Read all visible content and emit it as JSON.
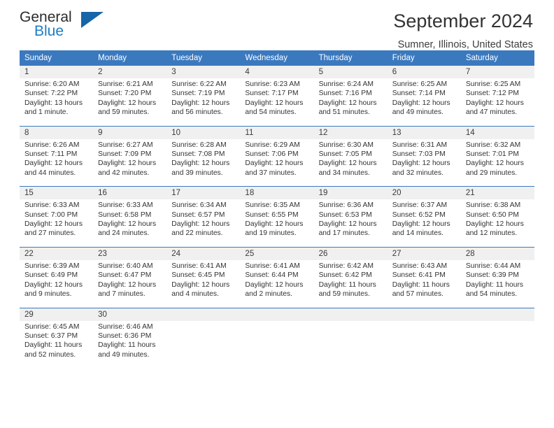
{
  "brand": {
    "name_part1": "General",
    "name_part2": "Blue",
    "accent_color": "#1d7cc2",
    "triangle_color": "#1565a8"
  },
  "header": {
    "title": "September 2024",
    "subtitle": "Sumner, Illinois, United States"
  },
  "theme": {
    "header_row_bg": "#3b79bf",
    "daynum_row_bg": "#f0f0f0",
    "text_color": "#333333"
  },
  "weekday_headers": [
    "Sunday",
    "Monday",
    "Tuesday",
    "Wednesday",
    "Thursday",
    "Friday",
    "Saturday"
  ],
  "labels": {
    "sunrise": "Sunrise:",
    "sunset": "Sunset:",
    "daylight": "Daylight:"
  },
  "weeks": [
    {
      "days": [
        {
          "num": "1",
          "sunrise": "Sunrise: 6:20 AM",
          "sunset": "Sunset: 7:22 PM",
          "daylight1": "Daylight: 13 hours",
          "daylight2": "and 1 minute."
        },
        {
          "num": "2",
          "sunrise": "Sunrise: 6:21 AM",
          "sunset": "Sunset: 7:20 PM",
          "daylight1": "Daylight: 12 hours",
          "daylight2": "and 59 minutes."
        },
        {
          "num": "3",
          "sunrise": "Sunrise: 6:22 AM",
          "sunset": "Sunset: 7:19 PM",
          "daylight1": "Daylight: 12 hours",
          "daylight2": "and 56 minutes."
        },
        {
          "num": "4",
          "sunrise": "Sunrise: 6:23 AM",
          "sunset": "Sunset: 7:17 PM",
          "daylight1": "Daylight: 12 hours",
          "daylight2": "and 54 minutes."
        },
        {
          "num": "5",
          "sunrise": "Sunrise: 6:24 AM",
          "sunset": "Sunset: 7:16 PM",
          "daylight1": "Daylight: 12 hours",
          "daylight2": "and 51 minutes."
        },
        {
          "num": "6",
          "sunrise": "Sunrise: 6:25 AM",
          "sunset": "Sunset: 7:14 PM",
          "daylight1": "Daylight: 12 hours",
          "daylight2": "and 49 minutes."
        },
        {
          "num": "7",
          "sunrise": "Sunrise: 6:25 AM",
          "sunset": "Sunset: 7:12 PM",
          "daylight1": "Daylight: 12 hours",
          "daylight2": "and 47 minutes."
        }
      ]
    },
    {
      "days": [
        {
          "num": "8",
          "sunrise": "Sunrise: 6:26 AM",
          "sunset": "Sunset: 7:11 PM",
          "daylight1": "Daylight: 12 hours",
          "daylight2": "and 44 minutes."
        },
        {
          "num": "9",
          "sunrise": "Sunrise: 6:27 AM",
          "sunset": "Sunset: 7:09 PM",
          "daylight1": "Daylight: 12 hours",
          "daylight2": "and 42 minutes."
        },
        {
          "num": "10",
          "sunrise": "Sunrise: 6:28 AM",
          "sunset": "Sunset: 7:08 PM",
          "daylight1": "Daylight: 12 hours",
          "daylight2": "and 39 minutes."
        },
        {
          "num": "11",
          "sunrise": "Sunrise: 6:29 AM",
          "sunset": "Sunset: 7:06 PM",
          "daylight1": "Daylight: 12 hours",
          "daylight2": "and 37 minutes."
        },
        {
          "num": "12",
          "sunrise": "Sunrise: 6:30 AM",
          "sunset": "Sunset: 7:05 PM",
          "daylight1": "Daylight: 12 hours",
          "daylight2": "and 34 minutes."
        },
        {
          "num": "13",
          "sunrise": "Sunrise: 6:31 AM",
          "sunset": "Sunset: 7:03 PM",
          "daylight1": "Daylight: 12 hours",
          "daylight2": "and 32 minutes."
        },
        {
          "num": "14",
          "sunrise": "Sunrise: 6:32 AM",
          "sunset": "Sunset: 7:01 PM",
          "daylight1": "Daylight: 12 hours",
          "daylight2": "and 29 minutes."
        }
      ]
    },
    {
      "days": [
        {
          "num": "15",
          "sunrise": "Sunrise: 6:33 AM",
          "sunset": "Sunset: 7:00 PM",
          "daylight1": "Daylight: 12 hours",
          "daylight2": "and 27 minutes."
        },
        {
          "num": "16",
          "sunrise": "Sunrise: 6:33 AM",
          "sunset": "Sunset: 6:58 PM",
          "daylight1": "Daylight: 12 hours",
          "daylight2": "and 24 minutes."
        },
        {
          "num": "17",
          "sunrise": "Sunrise: 6:34 AM",
          "sunset": "Sunset: 6:57 PM",
          "daylight1": "Daylight: 12 hours",
          "daylight2": "and 22 minutes."
        },
        {
          "num": "18",
          "sunrise": "Sunrise: 6:35 AM",
          "sunset": "Sunset: 6:55 PM",
          "daylight1": "Daylight: 12 hours",
          "daylight2": "and 19 minutes."
        },
        {
          "num": "19",
          "sunrise": "Sunrise: 6:36 AM",
          "sunset": "Sunset: 6:53 PM",
          "daylight1": "Daylight: 12 hours",
          "daylight2": "and 17 minutes."
        },
        {
          "num": "20",
          "sunrise": "Sunrise: 6:37 AM",
          "sunset": "Sunset: 6:52 PM",
          "daylight1": "Daylight: 12 hours",
          "daylight2": "and 14 minutes."
        },
        {
          "num": "21",
          "sunrise": "Sunrise: 6:38 AM",
          "sunset": "Sunset: 6:50 PM",
          "daylight1": "Daylight: 12 hours",
          "daylight2": "and 12 minutes."
        }
      ]
    },
    {
      "days": [
        {
          "num": "22",
          "sunrise": "Sunrise: 6:39 AM",
          "sunset": "Sunset: 6:49 PM",
          "daylight1": "Daylight: 12 hours",
          "daylight2": "and 9 minutes."
        },
        {
          "num": "23",
          "sunrise": "Sunrise: 6:40 AM",
          "sunset": "Sunset: 6:47 PM",
          "daylight1": "Daylight: 12 hours",
          "daylight2": "and 7 minutes."
        },
        {
          "num": "24",
          "sunrise": "Sunrise: 6:41 AM",
          "sunset": "Sunset: 6:45 PM",
          "daylight1": "Daylight: 12 hours",
          "daylight2": "and 4 minutes."
        },
        {
          "num": "25",
          "sunrise": "Sunrise: 6:41 AM",
          "sunset": "Sunset: 6:44 PM",
          "daylight1": "Daylight: 12 hours",
          "daylight2": "and 2 minutes."
        },
        {
          "num": "26",
          "sunrise": "Sunrise: 6:42 AM",
          "sunset": "Sunset: 6:42 PM",
          "daylight1": "Daylight: 11 hours",
          "daylight2": "and 59 minutes."
        },
        {
          "num": "27",
          "sunrise": "Sunrise: 6:43 AM",
          "sunset": "Sunset: 6:41 PM",
          "daylight1": "Daylight: 11 hours",
          "daylight2": "and 57 minutes."
        },
        {
          "num": "28",
          "sunrise": "Sunrise: 6:44 AM",
          "sunset": "Sunset: 6:39 PM",
          "daylight1": "Daylight: 11 hours",
          "daylight2": "and 54 minutes."
        }
      ]
    },
    {
      "days": [
        {
          "num": "29",
          "sunrise": "Sunrise: 6:45 AM",
          "sunset": "Sunset: 6:37 PM",
          "daylight1": "Daylight: 11 hours",
          "daylight2": "and 52 minutes."
        },
        {
          "num": "30",
          "sunrise": "Sunrise: 6:46 AM",
          "sunset": "Sunset: 6:36 PM",
          "daylight1": "Daylight: 11 hours",
          "daylight2": "and 49 minutes."
        },
        {
          "num": "",
          "sunrise": "",
          "sunset": "",
          "daylight1": "",
          "daylight2": ""
        },
        {
          "num": "",
          "sunrise": "",
          "sunset": "",
          "daylight1": "",
          "daylight2": ""
        },
        {
          "num": "",
          "sunrise": "",
          "sunset": "",
          "daylight1": "",
          "daylight2": ""
        },
        {
          "num": "",
          "sunrise": "",
          "sunset": "",
          "daylight1": "",
          "daylight2": ""
        },
        {
          "num": "",
          "sunrise": "",
          "sunset": "",
          "daylight1": "",
          "daylight2": ""
        }
      ]
    }
  ]
}
